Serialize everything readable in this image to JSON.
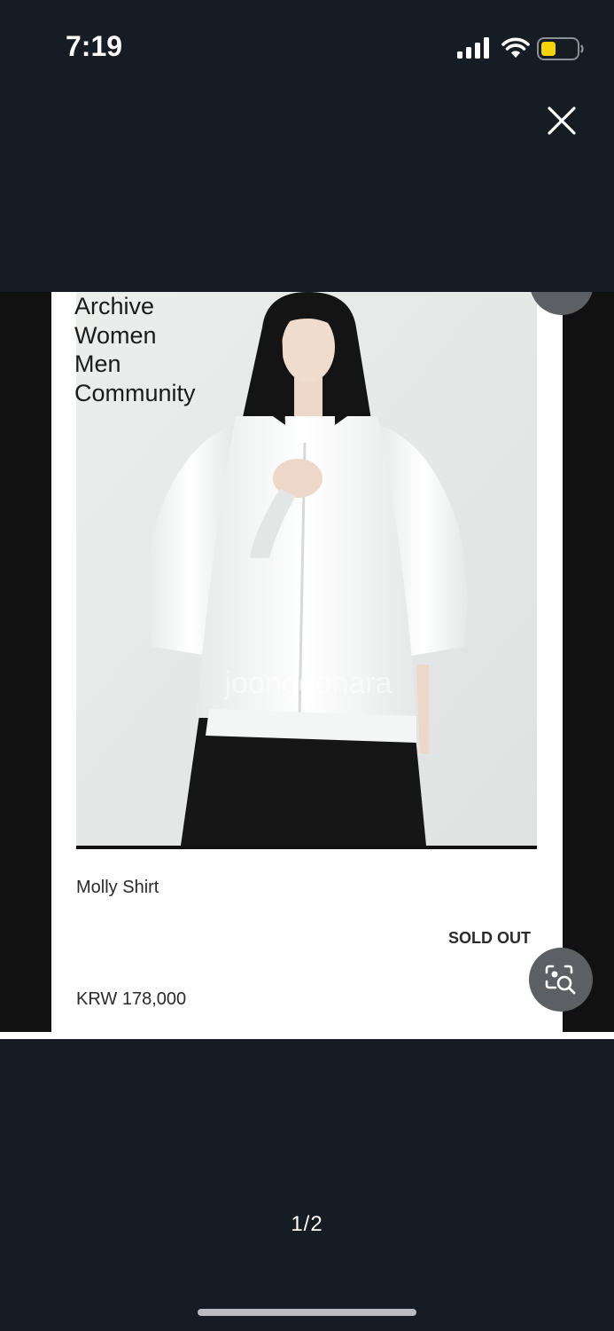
{
  "status_bar": {
    "time": "7:19"
  },
  "icons": {
    "signal": "cellular-signal-icon",
    "wifi": "wifi-icon",
    "battery": "battery-low-icon",
    "close": "close-icon",
    "lens": "visual-search-icon"
  },
  "colors": {
    "background": "#161c24",
    "battery_fill": "#f5d40a"
  },
  "product_page": {
    "nav_links": [
      "Archive",
      "Women",
      "Men",
      "Community"
    ],
    "watermark": "joonggonara",
    "product_name": "Molly Shirt",
    "availability": "SOLD OUT",
    "price": "KRW 178,000"
  },
  "viewer": {
    "page_indicator": "1/2"
  }
}
